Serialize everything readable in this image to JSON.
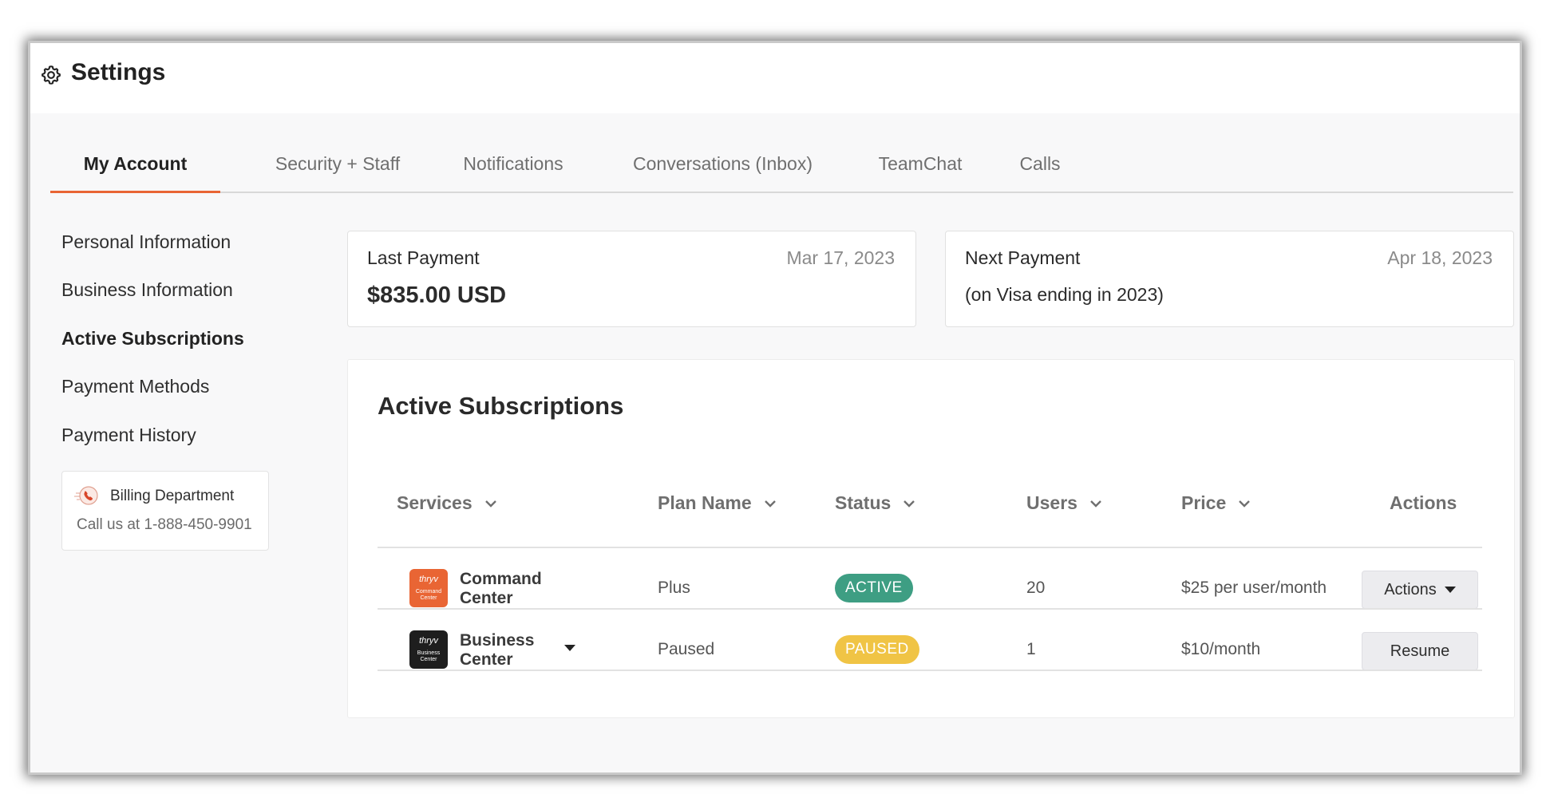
{
  "header": {
    "title": "Settings"
  },
  "tabs": [
    {
      "label": "My Account",
      "active": true
    },
    {
      "label": "Security + Staff"
    },
    {
      "label": "Notifications"
    },
    {
      "label": "Conversations (Inbox)"
    },
    {
      "label": "TeamChat"
    },
    {
      "label": "Calls"
    }
  ],
  "sidebar": {
    "items": [
      {
        "label": "Personal Information"
      },
      {
        "label": "Business Information"
      },
      {
        "label": "Active Subscriptions",
        "active": true
      },
      {
        "label": "Payment Methods"
      },
      {
        "label": "Payment History"
      }
    ],
    "billing": {
      "title": "Billing Department",
      "phone_text": "Call us at 1-888-450-9901"
    }
  },
  "last_payment": {
    "label": "Last Payment",
    "date": "Mar 17, 2023",
    "amount": "$835.00 USD"
  },
  "next_payment": {
    "label": "Next Payment",
    "date": "Apr 18, 2023",
    "note": "(on Visa ending in 2023)"
  },
  "subscriptions": {
    "title": "Active Subscriptions",
    "columns": [
      "Services",
      "Plan Name",
      "Status",
      "Users",
      "Price",
      "Actions"
    ],
    "rows": [
      {
        "service_line1": "Command",
        "service_line2": "Center",
        "logo_brand": "thryv",
        "logo_sub": "Command Center",
        "logo_color": "#e96534",
        "plan": "Plus",
        "status": "ACTIVE",
        "status_color": "#3e9e83",
        "users": "20",
        "price": "$25 per user/month",
        "action": "Actions"
      },
      {
        "service_line1": "Business",
        "service_line2": "Center",
        "logo_brand": "thryv",
        "logo_sub": "Business Center",
        "logo_color": "#1e1e1e",
        "plan": "Paused",
        "status": "PAUSED",
        "status_color": "#f0c445",
        "users": "1",
        "price": "$10/month",
        "action": "Resume"
      }
    ]
  },
  "colors": {
    "accent": "#e96534"
  }
}
